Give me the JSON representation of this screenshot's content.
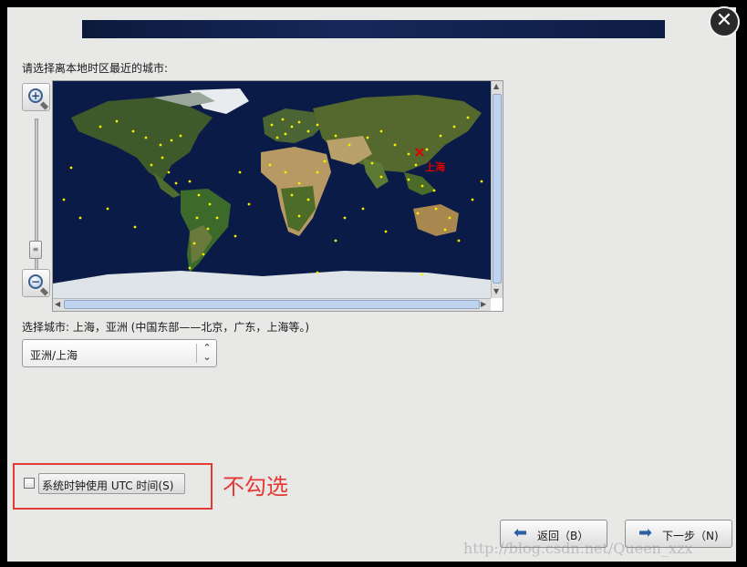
{
  "dialog": {
    "instruction": "请选择离本地时区最近的城市:",
    "selected_city_label": "选择城市: 上海，亚洲 (中国东部——北京，广东，上海等。)",
    "timezone_value": "亚洲/上海",
    "utc_checkbox_label": "系统时钟使用 UTC 时间(S)",
    "utc_checked": false,
    "back_button": "返回（B）",
    "next_button": "下一步（N)"
  },
  "map": {
    "marker_label": "上海",
    "marker_color": "#e00000",
    "city_dot_color": "#f4f000",
    "ocean_color": "#0b1b47"
  },
  "annotation": {
    "note": "不勾选",
    "color": "#e53935"
  },
  "icons": {
    "close": "close-icon",
    "zoom_in": "zoom-in-icon",
    "zoom_out": "zoom-out-icon",
    "back": "arrow-left-icon",
    "next": "arrow-right-icon"
  },
  "watermark": "http://blog.csdn.net/Queen_xzx"
}
